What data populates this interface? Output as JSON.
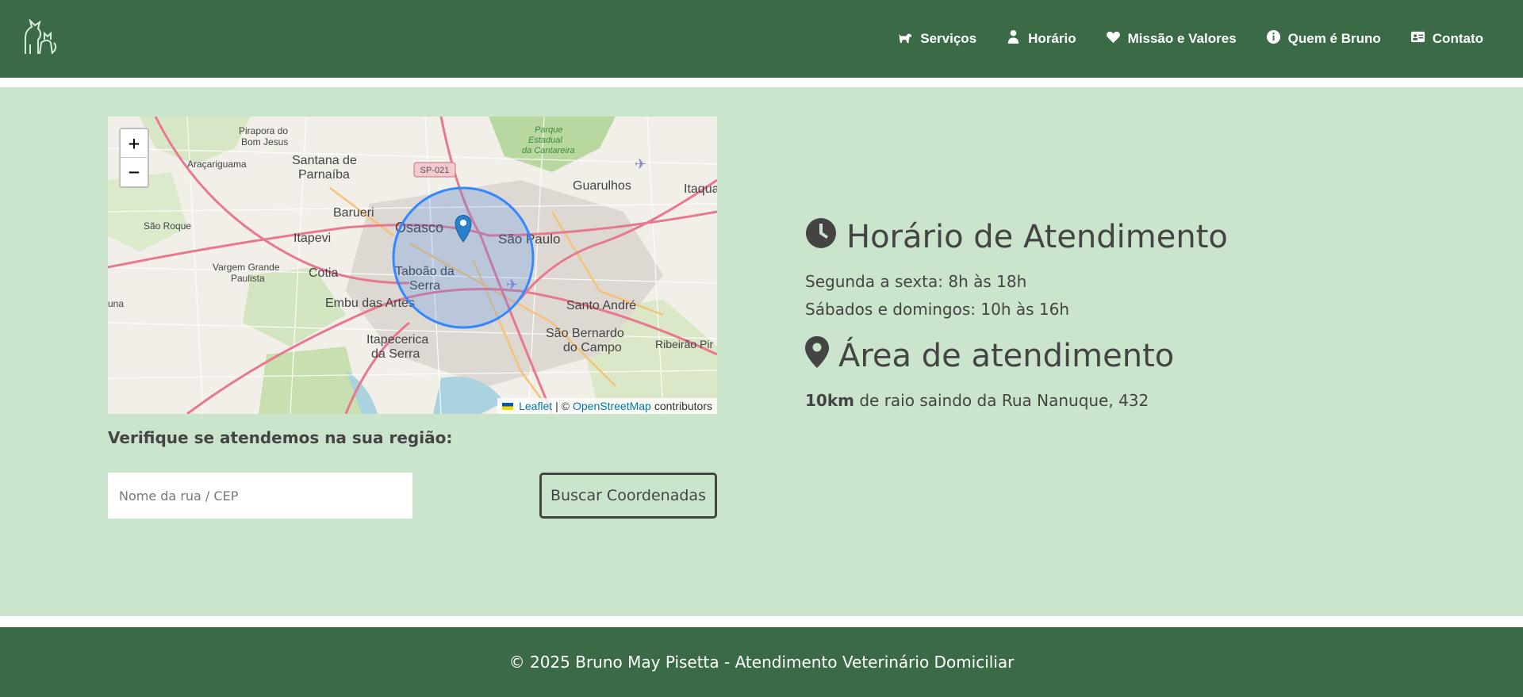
{
  "header": {
    "logo_icon": "dog-cat-outline-icon",
    "nav": [
      {
        "label": "Serviços",
        "icon": "dog-walking-icon"
      },
      {
        "label": "Horário",
        "icon": "user-doctor-icon"
      },
      {
        "label": "Missão e Valores",
        "icon": "heart-icon"
      },
      {
        "label": "Quem é Bruno",
        "icon": "info-circle-icon"
      },
      {
        "label": "Contato",
        "icon": "id-card-icon"
      }
    ]
  },
  "map": {
    "zoom_in": "+",
    "zoom_out": "−",
    "labels": {
      "pirapora": "Pirapora do",
      "bom_jesus": "Bom Jesus",
      "aracariguama": "Araçariguama",
      "santana": "Santana de",
      "parnaiba": "Parnaíba",
      "sp021": "SP-021",
      "parque": "Parque",
      "estadual": "Estadual",
      "cantareira": "da Cantareira",
      "guarulhos": "Guarulhos",
      "itaqua": "Itaqua",
      "barueri": "Barueri",
      "osasco": "Osasco",
      "sao_paulo": "São Paulo",
      "sao_roque": "São Roque",
      "itapevi": "Itapevi",
      "vargem": "Vargem Grande",
      "paulista": "Paulista",
      "cotia": "Cotia",
      "taboao": "Taboão da",
      "serra": "Serra",
      "embu": "Embu das Artes",
      "santo_andre": "Santo André",
      "itapecerica": "Itapecerica",
      "da_serra": "da Serra",
      "sao_bernardo": "São Bernardo",
      "do_campo": "do Campo",
      "ribeirao": "Ribeirão Pir",
      "una": "una"
    },
    "attribution": {
      "leaflet": "Leaflet",
      "separator": "| ©",
      "osm": "OpenStreetMap",
      "contributors": "contributors"
    }
  },
  "verify": {
    "label": "Verifique se atendemos na sua região:",
    "placeholder": "Nome da rua / CEP",
    "button": "Buscar Coordenadas"
  },
  "info": {
    "hours_title": "Horário de Atendimento",
    "weekdays": "Segunda a sexta: 8h às 18h",
    "weekends": "Sábados e domingos: 10h às 16h",
    "area_title": "Área de atendimento",
    "radius_value": "10km",
    "radius_text": " de raio saindo da Rua Nanuque, 432"
  },
  "footer": {
    "text": "© 2025 Bruno May Pisetta - Atendimento Veterinário Domiciliar"
  },
  "colors": {
    "header_bg": "#3a6b46",
    "main_bg": "#cbe4cc",
    "text": "#444444",
    "map_circle": "#3388ff",
    "link": "#0078a8"
  }
}
